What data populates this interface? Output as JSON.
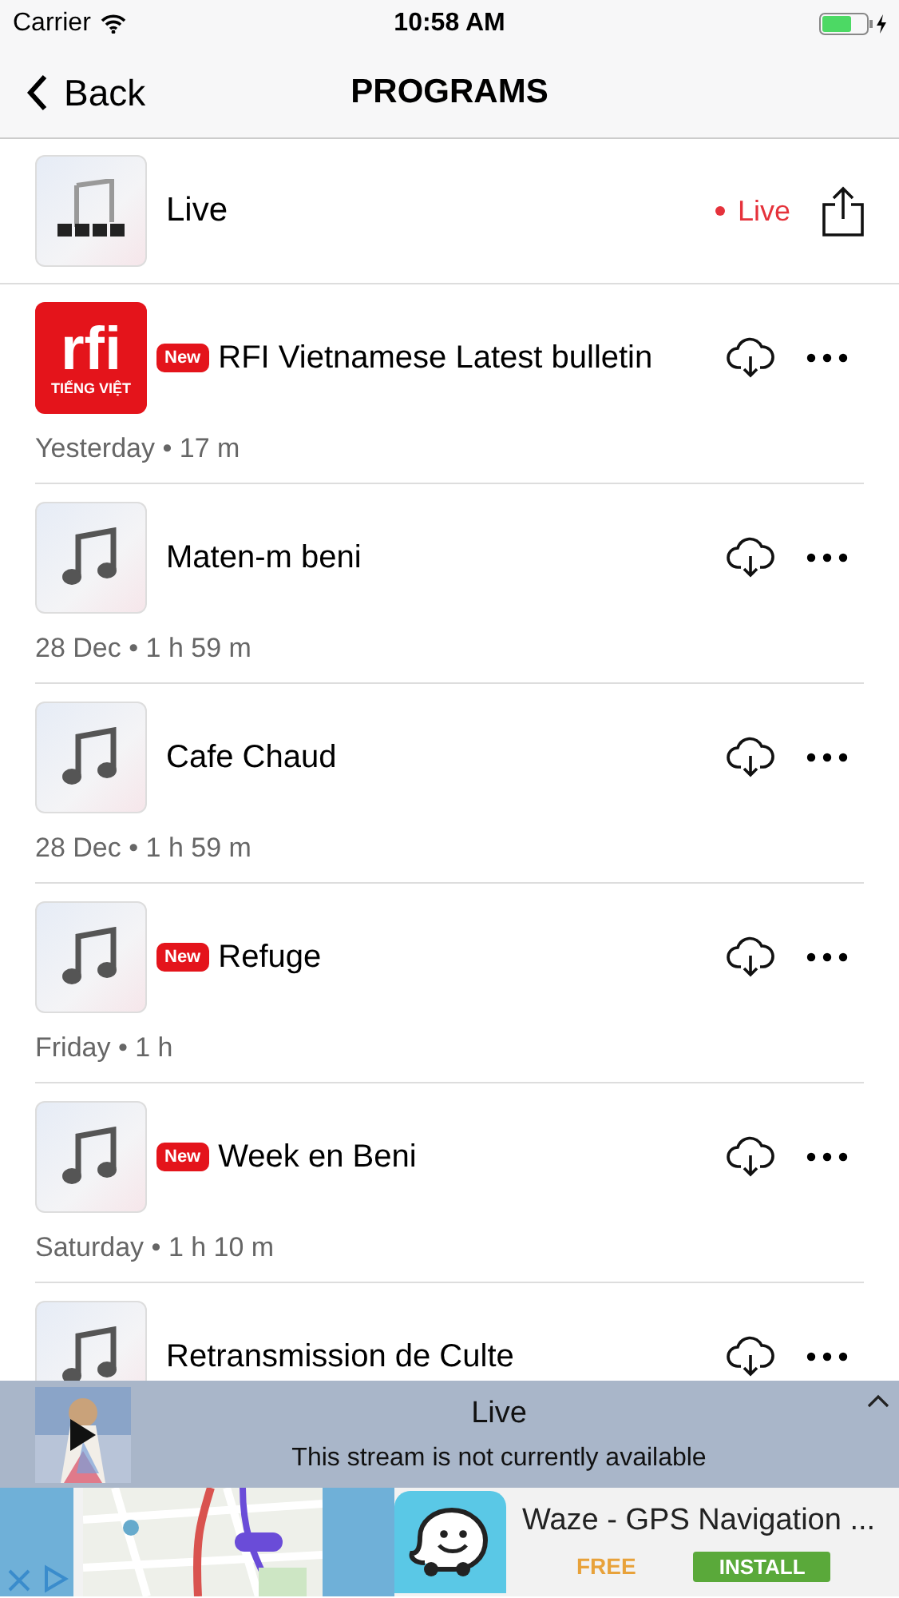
{
  "status_bar": {
    "carrier": "Carrier",
    "time": "10:58 AM"
  },
  "nav": {
    "back": "Back",
    "title": "PROGRAMS"
  },
  "live": {
    "title": "Live",
    "status": "Live"
  },
  "episodes": [
    {
      "kind": "logo",
      "logo": "rfi",
      "logo_caption": "TIẾNG VIỆT",
      "is_new": true,
      "badge": "New",
      "title": "RFI Vietnamese Latest bulletin",
      "meta": "Yesterday • 17 m"
    },
    {
      "kind": "note",
      "is_new": false,
      "title": "Maten-m beni",
      "meta": "28 Dec • 1 h 59 m"
    },
    {
      "kind": "note",
      "is_new": false,
      "title": "Cafe Chaud",
      "meta": "28 Dec • 1 h 59 m"
    },
    {
      "kind": "note",
      "is_new": true,
      "badge": "New",
      "title": "Refuge",
      "meta": "Friday • 1 h"
    },
    {
      "kind": "note",
      "is_new": true,
      "badge": "New",
      "title": "Week en Beni",
      "meta": "Saturday • 1 h 10 m"
    },
    {
      "kind": "note",
      "is_new": false,
      "title": "Retransmission de Culte"
    }
  ],
  "player": {
    "title": "Live",
    "message": "This stream is not currently available"
  },
  "ad": {
    "title": "Waze - GPS Navigation ...",
    "price": "FREE",
    "action": "INSTALL"
  }
}
